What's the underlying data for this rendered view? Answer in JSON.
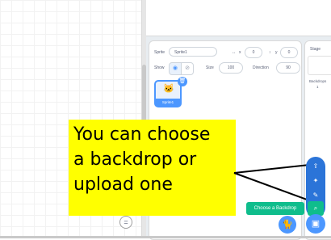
{
  "sprite_info": {
    "sprite_label": "Sprite",
    "sprite_name": "Sprite1",
    "x_label": "x",
    "x_value": "0",
    "y_label": "y",
    "y_value": "0",
    "show_label": "Show",
    "size_label": "Size",
    "size_value": "100",
    "direction_label": "Direction",
    "direction_value": "90"
  },
  "sprites": [
    {
      "name": "Sprite1"
    }
  ],
  "stage_pane": {
    "title": "Stage",
    "backdrops_label": "Backdrops",
    "backdrops_count": "1"
  },
  "callout": {
    "lines": [
      "You can choose",
      "a backdrop or",
      "upload one"
    ],
    "background": "#ffff00"
  },
  "tooltip": {
    "label": "Choose a Backdrop"
  },
  "icons": {
    "zoom_reset": "=",
    "upload": "upload-icon",
    "surprise": "sparkle-icon",
    "paint": "paintbrush-icon",
    "search": "search-icon",
    "choose_sprite": "choose-sprite-icon",
    "choose_backdrop": "choose-backdrop-icon"
  },
  "colors": {
    "accent_blue": "#4c97ff",
    "menu_blue": "#2b74d8",
    "hover_green": "#0fbd8c"
  }
}
